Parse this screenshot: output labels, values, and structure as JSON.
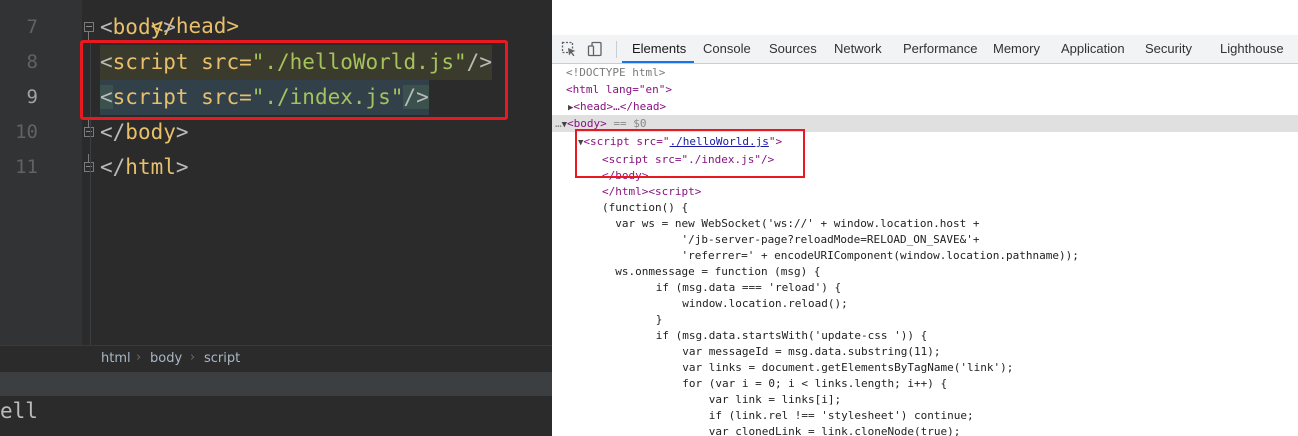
{
  "editor": {
    "line_numbers": [
      "7",
      "8",
      "9",
      "10",
      "11"
    ],
    "lines": [
      {
        "open": "<",
        "tag": "body",
        "close": ">"
      },
      {
        "open": "<",
        "tag": "script src=",
        "value": "\"./helloWorld.js\"",
        "close": "/>"
      },
      {
        "open": "<",
        "tag": "script src=",
        "value": "\"./index.js\"",
        "close": "/>"
      },
      {
        "open": "</",
        "tag": "body",
        "close": ">"
      },
      {
        "open": "</",
        "tag": "html",
        "close": ">"
      }
    ],
    "top_cut_line": "</head>",
    "breadcrumb": [
      "html",
      "body",
      "script"
    ],
    "breadcrumb_sep": "›",
    "console_output": "ell"
  },
  "devtools": {
    "tabs": [
      "Elements",
      "Console",
      "Sources",
      "Network",
      "Performance",
      "Memory",
      "Application",
      "Security",
      "Lighthouse"
    ],
    "active_tab": "Elements",
    "accent_color": "#1a73e8",
    "icons": [
      "inspect-element-icon",
      "device-toolbar-icon"
    ],
    "dom": {
      "doctype": "<!DOCTYPE html>",
      "html_open": "<html lang=\"en\">",
      "head": "<head>…</head>",
      "body_open": "<body>",
      "body_marker": " == $0",
      "script1_prefix": "<script src=\"",
      "script1_link": "./helloWorld.js",
      "script1_suffix": "\">",
      "script2": "<script src=\"./index.js\"/>",
      "body_close": "</body>",
      "html_close": "</html><script>",
      "js_lines": [
        "(function() {",
        "  var ws = new WebSocket('ws://' + window.location.host +",
        "            '/jb-server-page?reloadMode=RELOAD_ON_SAVE&'+",
        "            'referrer=' + encodeURIComponent(window.location.pathname));",
        "  ws.onmessage = function (msg) {",
        "      if (msg.data === 'reload') {",
        "          window.location.reload();",
        "      }",
        "      if (msg.data.startsWith('update-css ')) {",
        "          var messageId = msg.data.substring(11);",
        "          var links = document.getElementsByTagName('link');",
        "          for (var i = 0; i < links.length; i++) {",
        "              var link = links[i];",
        "              if (link.rel !== 'stylesheet') continue;",
        "              var clonedLink = link.cloneNode(true);"
      ]
    }
  }
}
